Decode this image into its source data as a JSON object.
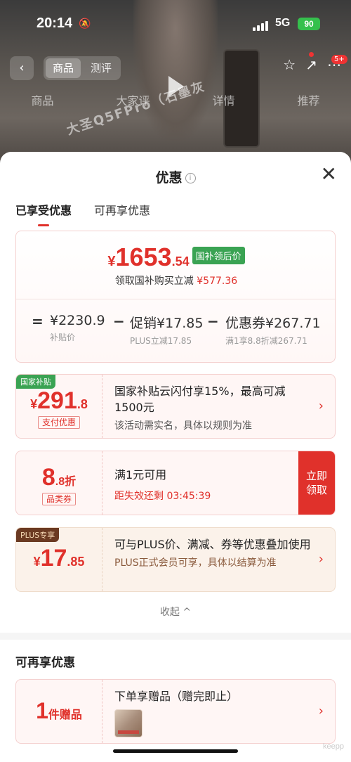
{
  "status": {
    "time": "20:14",
    "network": "5G",
    "battery": "90"
  },
  "nav": {
    "tabs": [
      "商品",
      "测评"
    ],
    "badge": "5+",
    "subtabs": [
      "商品",
      "大家评",
      "详情",
      "推荐"
    ]
  },
  "video_text": "大圣Q5FPro（石墨灰",
  "sheet": {
    "title": "优惠",
    "tabs": [
      "已享受优惠",
      "可再享优惠"
    ],
    "summary": {
      "yen": "¥",
      "price_int": "1653",
      "price_dec": ".54",
      "price_tag": "国补领后价",
      "claim_text": "领取国补购买立减",
      "claim_amount": "¥577.36",
      "breakdown": [
        {
          "value": "¥2230.9",
          "label": "补贴价"
        },
        {
          "value": "促销¥17.85",
          "label": "PLUS立减17.85"
        },
        {
          "value": "优惠券¥267.71",
          "label": "满1享8.8折减267.71"
        }
      ],
      "ops": [
        "=",
        "−",
        "−"
      ]
    },
    "coupons": [
      {
        "corner": "国家补贴",
        "yen": "¥",
        "amt_int": "291",
        "amt_dec": ".8",
        "sub_tag": "支付优惠",
        "title": "国家补贴云闪付享15%，最高可减1500元",
        "desc": "该活动需实名，具体以规则为准"
      },
      {
        "amt_int": "8",
        "amt_dec": ".8折",
        "sub_tag": "品类券",
        "title": "满1元可用",
        "countdown": "距失效还剩 03:45:39",
        "button": "立即领取"
      },
      {
        "corner": "PLUS专享",
        "yen": "¥",
        "amt_int": "17",
        "amt_dec": ".85",
        "title": "可与PLUS价、满减、券等优惠叠加使用",
        "desc": "PLUS正式会员可享，具体以结算为准"
      }
    ],
    "collapse": "收起 ^",
    "more_section": {
      "title": "可再享优惠",
      "gift": {
        "amt": "1",
        "unit": "件赠品",
        "title": "下单享赠品（赠完即止）"
      }
    }
  },
  "watermark": "keepp"
}
